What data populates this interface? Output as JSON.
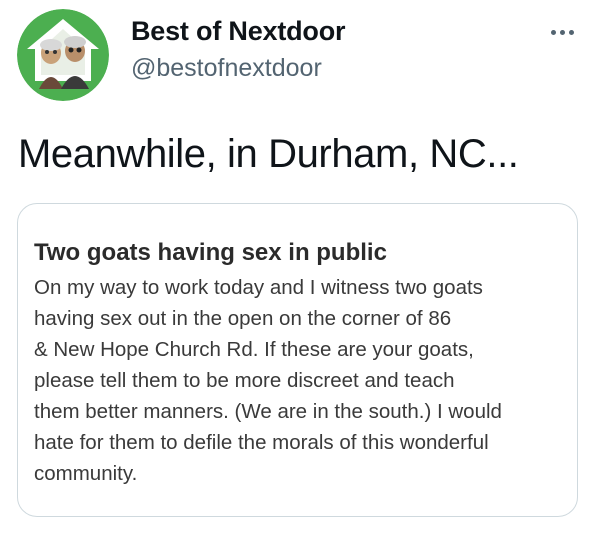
{
  "author": {
    "display_name": "Best of Nextdoor",
    "handle": "@bestofnextdoor",
    "avatar_icon": "muppets-house-logo-icon",
    "avatar_color": "#4caf50"
  },
  "tweet": {
    "text": "Meanwhile, in Durham, NC..."
  },
  "more_menu": {
    "icon": "more-dots-icon"
  },
  "nextdoor_post": {
    "title": "Two goats having sex in public",
    "body_lines": [
      "On my way to work today and I witness two goats",
      "having sex out in the open on the corner of 86",
      "& New Hope Church Rd. If these are your goats,",
      "please tell them to be more discreet and teach",
      "them better manners. (We are in the south.) I would",
      "hate for them to defile the morals of this wonderful",
      "community."
    ]
  },
  "colors": {
    "text_primary": "#0f1419",
    "text_secondary": "#536471",
    "card_border": "#cfd9de",
    "post_text": "#3a3a3a"
  }
}
